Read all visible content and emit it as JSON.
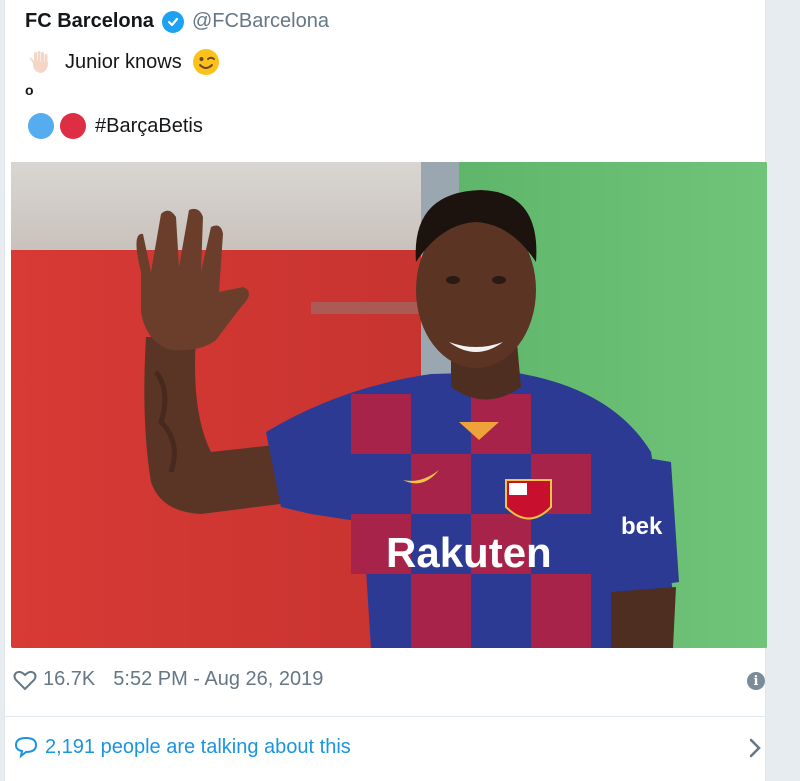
{
  "tweet": {
    "author_name": "FC Barcelona",
    "author_handle": "@FCBarcelona",
    "text_line1": "Junior knows",
    "text_dot": "o",
    "hashtag": "#BarçaBetis",
    "sponsor_chest": "Rakuten",
    "sponsor_sleeve": "bek",
    "like_count": "16.7K",
    "timestamp": "5:52 PM - Aug 26, 2019",
    "conversation_text": "2,191 people are talking about this"
  },
  "icons": {
    "verified": "verified-badge-icon",
    "wave": "raised-hand-icon",
    "wink": "winking-face-icon",
    "blue_circle": "blue-circle-icon",
    "red_circle": "red-circle-icon",
    "heart": "heart-icon",
    "info": "info-icon",
    "comment": "comment-bubble-icon",
    "chevron": "chevron-right-icon"
  },
  "colors": {
    "twitter_blue": "#1da1f2",
    "link_blue": "#1b95e0",
    "muted": "#657786"
  }
}
